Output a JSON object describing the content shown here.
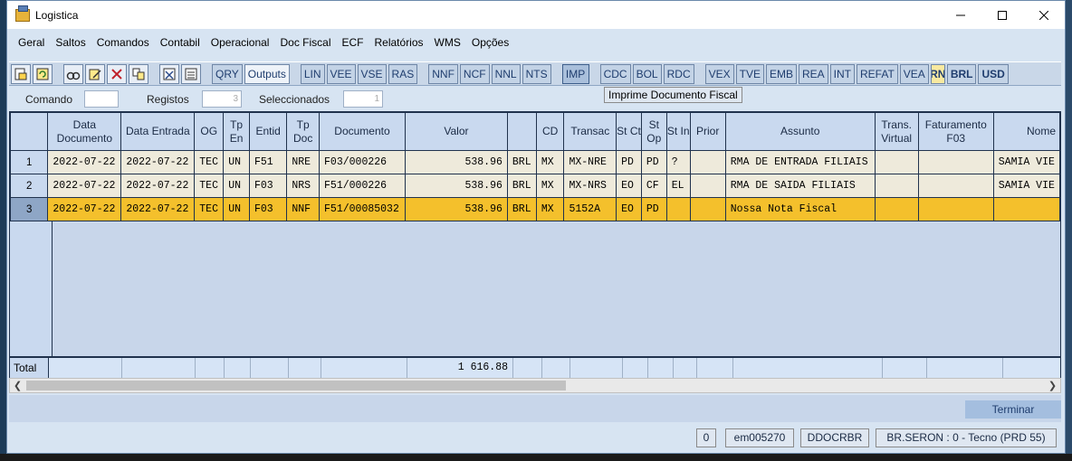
{
  "window": {
    "title": "Logistica"
  },
  "menu": [
    "Geral",
    "Saltos",
    "Comandos",
    "Contabil",
    "Operacional",
    "Doc Fiscal",
    "ECF",
    "Relatórios",
    "WMS",
    "Opções"
  ],
  "toolbar": {
    "icons": [
      "print-preview-icon",
      "refresh-icon",
      "binoculars-icon",
      "edit-document-icon",
      "delete-icon",
      "copy-icon",
      "calculator-icon",
      "report-icon"
    ],
    "buttons": [
      "QRY",
      "Outputs",
      "LIN",
      "VEE",
      "VSE",
      "RAS",
      "NNF",
      "NCF",
      "NNL",
      "NTS",
      "IMP",
      "CDC",
      "BOL",
      "RDC",
      "VEX",
      "TVE",
      "EMB",
      "REA",
      "INT",
      "REFAT",
      "VEA",
      "RN",
      "BRL",
      "USD"
    ],
    "tooltip": "Imprime Documento Fiscal"
  },
  "filter": {
    "comando_label": "Comando",
    "comando_value": "",
    "registos_label": "Registos",
    "registos_value": "3",
    "seleccionados_label": "Seleccionados",
    "seleccionados_value": "1"
  },
  "table": {
    "headers": [
      "Data Documento",
      "Data Entrada",
      "OG",
      "Tp En",
      "Entid",
      "Tp Doc",
      "Documento",
      "Valor",
      "",
      "CD",
      "Transac",
      "St Ct",
      "St Op",
      "St In",
      "Prior",
      "Assunto",
      "Trans. Virtual",
      "Faturamento F03",
      "Nome"
    ],
    "rows": [
      [
        "1",
        "2022-07-22",
        "2022-07-22",
        "TEC",
        "UN",
        "F51",
        "NRE",
        "F03/000226",
        "538.96",
        "BRL",
        "MX",
        "MX-NRE",
        "PD",
        "PD",
        "?",
        "",
        "RMA DE ENTRADA FILIAIS",
        "",
        "",
        "SAMIA VIE"
      ],
      [
        "2",
        "2022-07-22",
        "2022-07-22",
        "TEC",
        "UN",
        "F03",
        "NRS",
        "F51/000226",
        "538.96",
        "BRL",
        "MX",
        "MX-NRS",
        "EO",
        "CF",
        "EL",
        "",
        "RMA DE SAIDA FILIAIS",
        "",
        "",
        "SAMIA VIE"
      ],
      [
        "3",
        "2022-07-22",
        "2022-07-22",
        "TEC",
        "UN",
        "F03",
        "NNF",
        "F51/00085032",
        "538.96",
        "BRL",
        "MX",
        "5152A",
        "EO",
        "PD",
        "",
        "",
        "Nossa Nota Fiscal",
        "",
        "",
        ""
      ]
    ],
    "total_label": "Total",
    "total_value": "1 616.88"
  },
  "actions": {
    "terminar": "Terminar"
  },
  "status": [
    "0",
    "em005270",
    "DDOCRBR",
    "BR.SERON : 0 - Tecno (PRD 55)"
  ]
}
